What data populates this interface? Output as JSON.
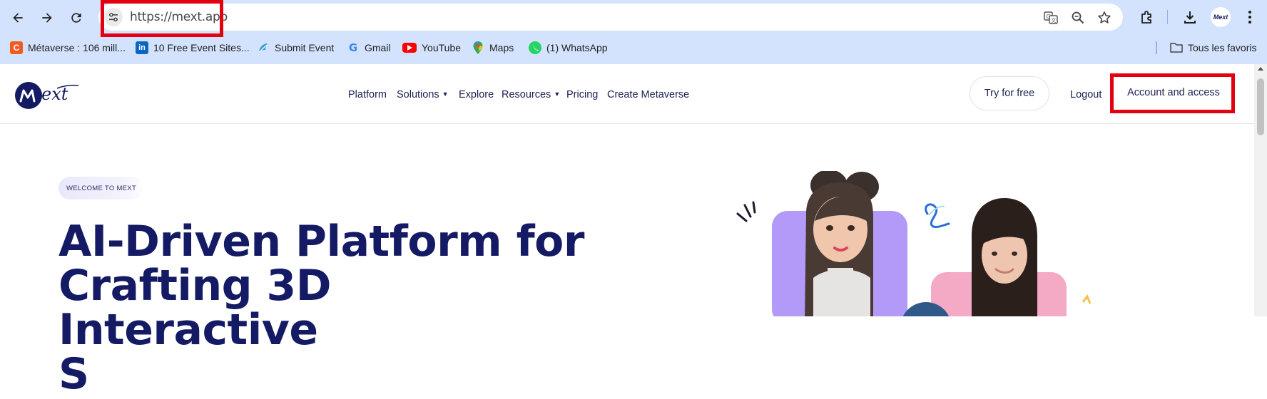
{
  "browser": {
    "url": "https://mext.app",
    "bookmarks": [
      {
        "label": "Métaverse : 106 mill...",
        "icon": "c-logo-icon",
        "color": "#f15a22"
      },
      {
        "label": "10 Free Event Sites...",
        "icon": "linkedin-icon",
        "color": "#0a66c2"
      },
      {
        "label": "Submit Event",
        "icon": "submit-event-icon",
        "color": "#3aa0e0"
      },
      {
        "label": "Gmail",
        "icon": "google-icon",
        "color": "#4285f4"
      },
      {
        "label": "YouTube",
        "icon": "youtube-icon",
        "color": "#ff0000"
      },
      {
        "label": "Maps",
        "icon": "maps-icon",
        "color": "#34a853"
      },
      {
        "label": "(1) WhatsApp",
        "icon": "whatsapp-icon",
        "color": "#25d366"
      }
    ],
    "all_bookmarks_label": "Tous les favoris"
  },
  "site": {
    "logo_text": "Mext",
    "nav": {
      "platform": "Platform",
      "solutions": "Solutions",
      "explore": "Explore",
      "resources": "Resources",
      "pricing": "Pricing",
      "create_metaverse": "Create Metaverse"
    },
    "try_free": "Try for free",
    "logout": "Logout",
    "account": "Account and access"
  },
  "hero": {
    "badge": "WELCOME TO MEXT",
    "title_line1": "AI-Driven Platform for",
    "title_line2": "Crafting 3D Interactive",
    "title_line3": "S"
  },
  "colors": {
    "brand_navy": "#141a63",
    "highlight_red": "#e3000f",
    "chrome_blue": "#d3e3fd"
  }
}
